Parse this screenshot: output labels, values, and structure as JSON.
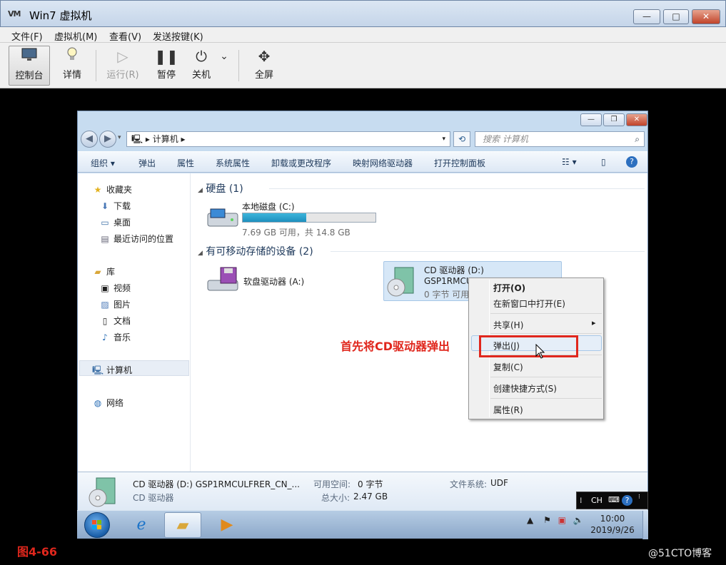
{
  "host": {
    "logo": "VM",
    "title": "Win7 虚拟机",
    "window_controls": {
      "minimize": "—",
      "maximize": "□",
      "close": "✕"
    },
    "menu": [
      "文件(F)",
      "虚拟机(M)",
      "查看(V)",
      "发送按键(K)"
    ],
    "toolbar": [
      {
        "label": "控制台",
        "icon": "monitor-icon",
        "active": true
      },
      {
        "label": "详情",
        "icon": "bulb-icon"
      },
      {
        "label": "运行(R)",
        "icon": "play-icon",
        "disabled": true
      },
      {
        "label": "暂停",
        "icon": "pause-icon"
      },
      {
        "label": "关机",
        "icon": "power-icon"
      },
      {
        "label": "全屏",
        "icon": "fullscreen-icon"
      }
    ]
  },
  "explorer": {
    "address": "计算机",
    "search_placeholder": "搜索 计算机",
    "commands": [
      "组织 ▾",
      "弹出",
      "属性",
      "系统属性",
      "卸载或更改程序",
      "映射网络驱动器",
      "打开控制面板"
    ],
    "nav": {
      "favorites": "收藏夹",
      "favorites_items": [
        "下载",
        "桌面",
        "最近访问的位置"
      ],
      "libraries": "库",
      "libraries_items": [
        "视频",
        "图片",
        "文档",
        "音乐"
      ],
      "computer": "计算机",
      "network": "网络"
    },
    "groups": {
      "hdd_header": "硬盘 (1)",
      "removable_header": "有可移动存储的设备 (2)"
    },
    "drives": {
      "local_c": {
        "name": "本地磁盘 (C:)",
        "space": "7.69 GB 可用，共 14.8 GB",
        "used_fraction": 0.48
      },
      "floppy": {
        "name": "软盘驱动器 (A:)"
      },
      "cd": {
        "name": "CD 驱动器 (D:)",
        "label": "GSP1RMCU",
        "free": "0 字节 可用"
      }
    },
    "annotation": "首先将CD驱动器弹出",
    "context_menu": {
      "items": [
        "打开(O)",
        "在新窗口中打开(E)",
        "共享(H)",
        "弹出(J)",
        "复制(C)",
        "创建快捷方式(S)",
        "属性(R)"
      ],
      "submenu_arrow": "▸"
    },
    "details": {
      "title": "CD 驱动器 (D:) GSP1RMCULFRER_CN_...",
      "type": "CD 驱动器",
      "free_label": "可用空间:",
      "free_value": "0 字节",
      "total_label": "总大小:",
      "total_value": "2.47 GB",
      "fs_label": "文件系统:",
      "fs_value": "UDF"
    }
  },
  "taskbar": {
    "clock_time": "10:00",
    "clock_date": "2019/9/26",
    "lang": "CH"
  },
  "figure_label": "图4-66",
  "watermark": "@51CTO博客",
  "colors": {
    "annotation_red": "#e0271d",
    "selection_blue": "#d6e7f7",
    "capacity_fill": "#1e8fbe"
  }
}
